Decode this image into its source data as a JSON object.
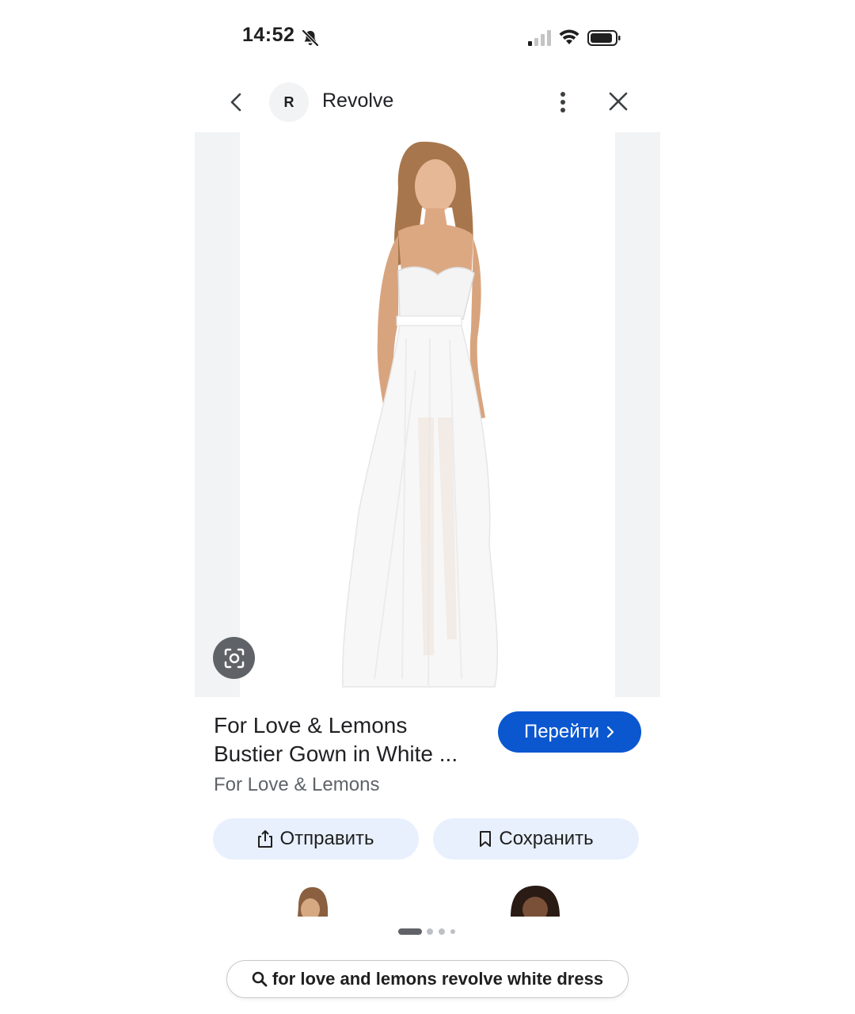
{
  "status_bar": {
    "time": "14:52"
  },
  "header": {
    "logo_letter": "R",
    "site_name": "Revolve"
  },
  "product": {
    "title_line1": "For Love & Lemons",
    "title_line2": "Bustier Gown in White ...",
    "source": "For Love & Lemons"
  },
  "buttons": {
    "visit": "Перейти",
    "share": "Отправить",
    "save": "Сохранить"
  },
  "search": {
    "query": "for love and lemons revolve white dress"
  },
  "pager": {
    "pages": 4,
    "current": 1
  },
  "colors": {
    "accent": "#0b57d0",
    "tonal_button": "#e8f0fe",
    "panel_bg": "#f1f3f4",
    "lens_button": "#5f6368"
  }
}
